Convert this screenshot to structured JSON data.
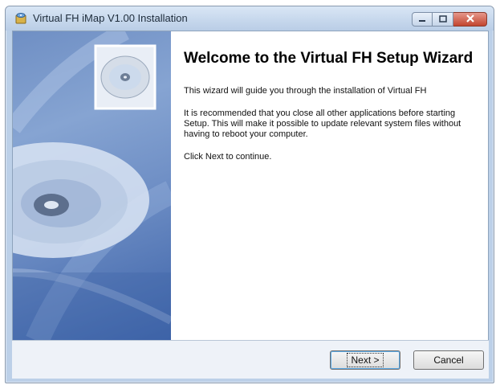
{
  "window": {
    "title": "Virtual FH iMap V1.00 Installation"
  },
  "content": {
    "heading": "Welcome to the Virtual FH Setup Wizard",
    "paragraphs": [
      "This wizard will guide you through the installation of Virtual FH",
      "It is recommended that you close all other applications before starting Setup. This will make it possible to update relevant system files without having to reboot your computer.",
      "Click Next to continue."
    ]
  },
  "buttons": {
    "next": "Next >",
    "cancel": "Cancel"
  },
  "icons": {
    "app": "installer-icon",
    "minimize": "minimize-icon",
    "maximize": "maximize-icon",
    "close": "close-icon",
    "banner": "cd-disc-icon"
  },
  "colors": {
    "title_bar": "#c8daf0",
    "close_button": "#c7503c",
    "banner_blue": "#6f8fc4"
  }
}
